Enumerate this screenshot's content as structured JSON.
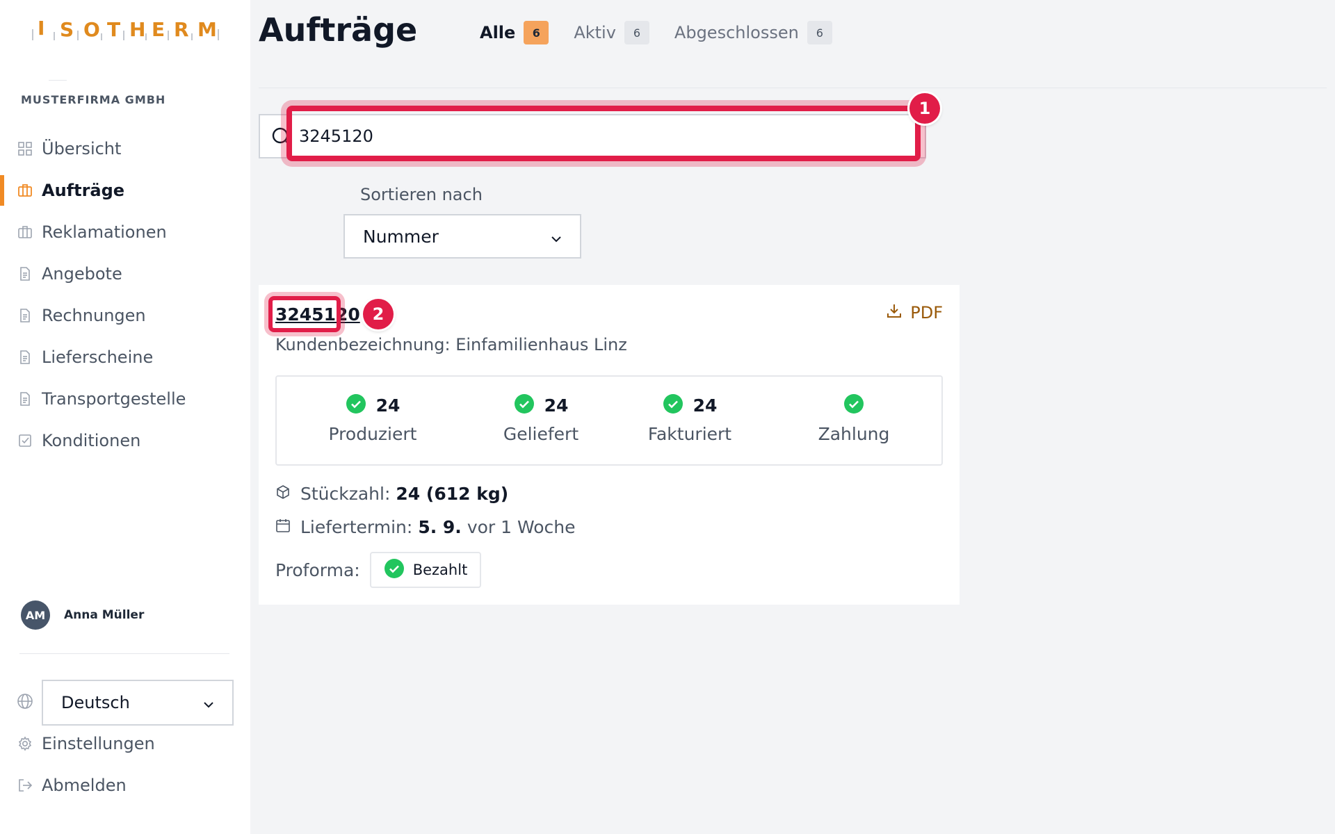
{
  "brand": {
    "logo_text": "ISOTHERM",
    "accent_color": "#f08a24"
  },
  "sidebar": {
    "company": "MUSTERFIRMA GMBH",
    "items": [
      {
        "label": "Übersicht",
        "icon": "grid-icon",
        "active": false
      },
      {
        "label": "Aufträge",
        "icon": "briefcase-icon",
        "active": true
      },
      {
        "label": "Reklamationen",
        "icon": "briefcase-icon",
        "active": false
      },
      {
        "label": "Angebote",
        "icon": "document-icon",
        "active": false
      },
      {
        "label": "Rechnungen",
        "icon": "document-icon",
        "active": false
      },
      {
        "label": "Lieferscheine",
        "icon": "document-icon",
        "active": false
      },
      {
        "label": "Transportgestelle",
        "icon": "document-icon",
        "active": false
      },
      {
        "label": "Konditionen",
        "icon": "checkbox-icon",
        "active": false
      }
    ],
    "user": {
      "initials": "AM",
      "name": "Anna Müller"
    },
    "language": {
      "selected": "Deutsch"
    },
    "settings_label": "Einstellungen",
    "logout_label": "Abmelden"
  },
  "header": {
    "title": "Aufträge",
    "tabs": [
      {
        "label": "Alle",
        "count": "6",
        "active": true
      },
      {
        "label": "Aktiv",
        "count": "6",
        "active": false
      },
      {
        "label": "Abgeschlossen",
        "count": "6",
        "active": false
      }
    ]
  },
  "search": {
    "value": "3245120",
    "placeholder": ""
  },
  "sort": {
    "label": "Sortieren nach",
    "selected": "Nummer"
  },
  "markers": {
    "m1": "1",
    "m2": "2"
  },
  "order": {
    "number": "3245120",
    "pdf_label": "PDF",
    "customer_label": "Kundenbezeichnung: Einfamilienhaus Linz",
    "statuses": [
      {
        "count": "24",
        "label": "Produziert"
      },
      {
        "count": "24",
        "label": "Geliefert"
      },
      {
        "count": "24",
        "label": "Fakturiert"
      },
      {
        "count": "",
        "label": "Zahlung"
      }
    ],
    "quantity_label": "Stückzahl:",
    "quantity_value": "24 (612 kg)",
    "delivery_label": "Liefertermin:",
    "delivery_value": "5. 9.",
    "delivery_relative": "vor 1 Woche",
    "proforma_label": "Proforma:",
    "proforma_status": "Bezahlt"
  },
  "colors": {
    "highlight": "#e11d48",
    "success": "#22c55e"
  }
}
